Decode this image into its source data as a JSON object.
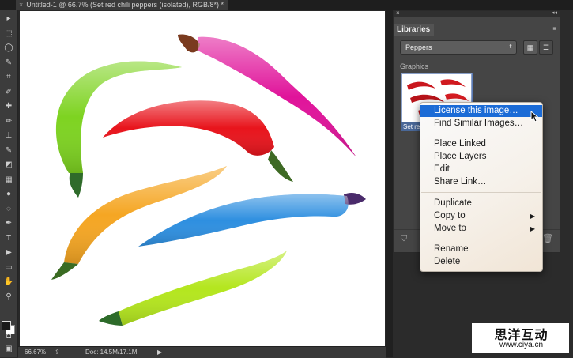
{
  "document": {
    "tab_close": "×",
    "tab_title": "Untitled-1 @ 66.7% (Set red chili peppers (isolated), RGB/8*) *"
  },
  "tools": [
    "move-tool-icon",
    "marquee-tool-icon",
    "lasso-tool-icon",
    "quick-select-tool-icon",
    "crop-tool-icon",
    "eyedropper-tool-icon",
    "healing-brush-tool-icon",
    "brush-tool-icon",
    "clone-stamp-tool-icon",
    "history-brush-tool-icon",
    "eraser-tool-icon",
    "gradient-tool-icon",
    "blur-tool-icon",
    "dodge-tool-icon",
    "pen-tool-icon",
    "type-tool-icon",
    "path-select-tool-icon",
    "shape-tool-icon",
    "hand-tool-icon",
    "zoom-tool-icon"
  ],
  "tool_glyphs": [
    "▸",
    "⬚",
    "◯",
    "✎",
    "⌗",
    "✐",
    "✚",
    "✏",
    "⊥",
    "✎",
    "◩",
    "▦",
    "●",
    "◌",
    "✒",
    "T",
    "▶",
    "▭",
    "✋",
    "⚲"
  ],
  "status": {
    "zoom": "66.67%",
    "doc": "Doc: 14.5M/17.1M"
  },
  "libraries": {
    "tab_label": "Libraries",
    "selected_library": "Peppers",
    "section_label": "Graphics",
    "thumbnail_caption": "Set re"
  },
  "context_menu": {
    "items": [
      {
        "label": "License this image…",
        "highlighted": true,
        "submenu": false
      },
      {
        "label": "Find Similar Images…",
        "highlighted": false,
        "submenu": false
      },
      {
        "label": "Place Linked",
        "highlighted": false,
        "submenu": false
      },
      {
        "label": "Place Layers",
        "highlighted": false,
        "submenu": false
      },
      {
        "label": "Edit",
        "highlighted": false,
        "submenu": false
      },
      {
        "label": "Share Link…",
        "highlighted": false,
        "submenu": false
      },
      {
        "label": "Duplicate",
        "highlighted": false,
        "submenu": false
      },
      {
        "label": "Copy to",
        "highlighted": false,
        "submenu": true
      },
      {
        "label": "Move to",
        "highlighted": false,
        "submenu": true
      },
      {
        "label": "Rename",
        "highlighted": false,
        "submenu": false
      },
      {
        "label": "Delete",
        "highlighted": false,
        "submenu": false
      }
    ]
  },
  "pepper_colors": [
    "#7ed321",
    "#e0139a",
    "#e8141c",
    "#f5a623",
    "#2e8fe0",
    "#b4e61e"
  ],
  "watermark": {
    "title": "思洋互动",
    "url": "www.ciya.cn"
  }
}
